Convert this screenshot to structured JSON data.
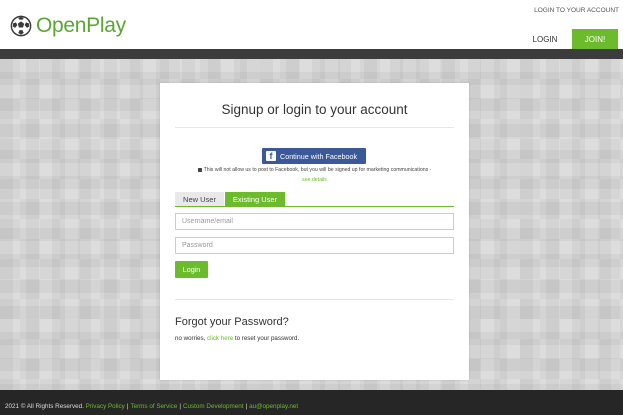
{
  "brand": {
    "name": "OpenPlay",
    "accent_color": "#6cbb2d"
  },
  "header": {
    "top_link": "LOGIN TO YOUR ACCOUNT",
    "nav_login": "LOGIN",
    "nav_join": "JOIN!"
  },
  "card": {
    "title": "Signup or login to your account",
    "facebook_button": "Continue with Facebook",
    "facebook_note": "This will not allow us to post to Facebook, but you will be signed up for marketing communications -",
    "see_details": "see details",
    "tabs": [
      {
        "label": "New User",
        "active": false
      },
      {
        "label": "Existing User",
        "active": true
      }
    ],
    "username_placeholder": "Username/email",
    "password_placeholder": "Password",
    "login_button": "Login",
    "forgot_title": "Forgot your Password?",
    "forgot_prefix": "no worries,",
    "forgot_link": "click here",
    "forgot_suffix": "to reset your password."
  },
  "footer": {
    "copyright": "2021 © All Rights Reserved.",
    "links": [
      "Privacy Policy",
      "Terms of Service",
      "Custom Development",
      "au@openplay.net"
    ]
  }
}
